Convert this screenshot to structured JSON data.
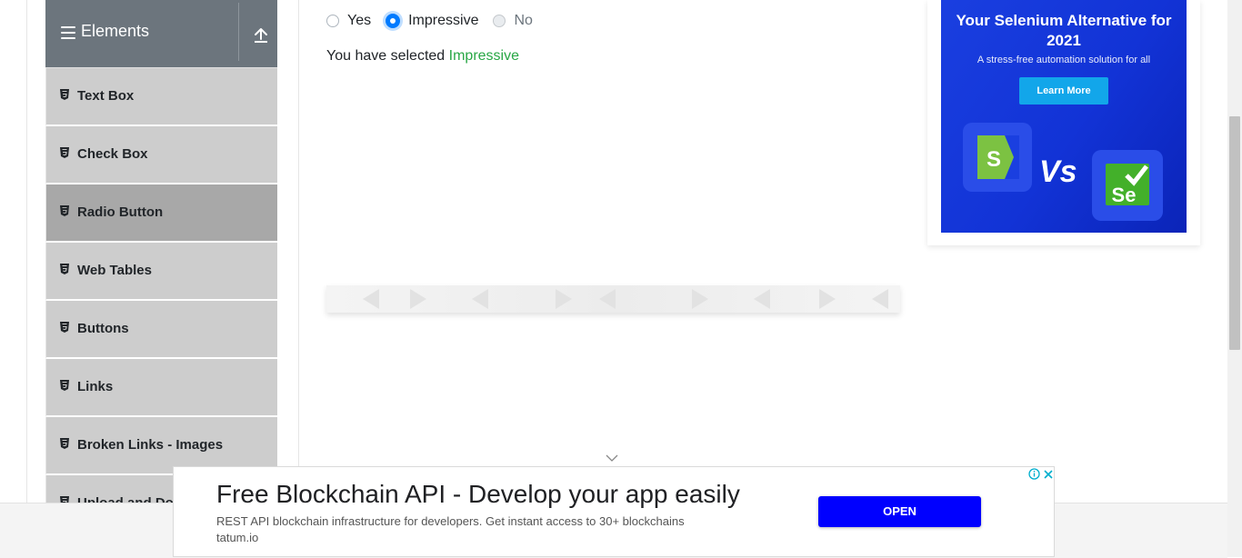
{
  "sidebar": {
    "group_title": "Elements",
    "items": [
      {
        "label": "Text Box"
      },
      {
        "label": "Check Box"
      },
      {
        "label": "Radio Button",
        "active": true
      },
      {
        "label": "Web Tables"
      },
      {
        "label": "Buttons"
      },
      {
        "label": "Links"
      },
      {
        "label": "Broken Links - Images"
      },
      {
        "label": "Upload and Download"
      }
    ]
  },
  "radio": {
    "options": [
      {
        "label": "Yes",
        "checked": false,
        "disabled": false
      },
      {
        "label": "Impressive",
        "checked": true,
        "disabled": false
      },
      {
        "label": "No",
        "checked": false,
        "disabled": true
      }
    ],
    "result_prefix": "You have selected",
    "result_value": "Impressive"
  },
  "side_ad": {
    "headline": "Your Selenium Alternative for 2021",
    "subtext": "A stress-free automation solution for all",
    "cta": "Learn More",
    "vs_text": "Vs",
    "logo_left": "S",
    "logo_right": "Se",
    "colors": {
      "background": "#1233d6",
      "cta": "#12a6ea",
      "left_logo": "#7cc242",
      "right_logo": "#43b02a"
    }
  },
  "bottom_ad": {
    "title": "Free Blockchain API - Develop your app easily",
    "description": "REST API blockchain infrastructure for developers. Get instant access to 30+ blockchains",
    "url": "tatum.io",
    "cta": "OPEN"
  },
  "colors": {
    "sidebar_header": "#6c757d",
    "menu_item": "#cdcdcd",
    "menu_item_active": "#a8a8a8",
    "success": "#28a745",
    "radio_checked": "#007bff",
    "ad_button": "#0000ff"
  }
}
